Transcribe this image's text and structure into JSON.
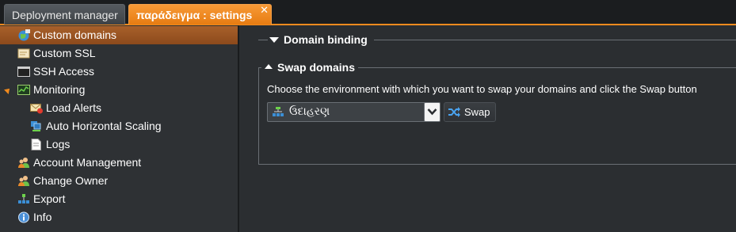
{
  "tabs": [
    {
      "label": "Deployment manager",
      "active": false
    },
    {
      "label": "παράδειγμα : settings",
      "active": true,
      "close_glyph": "✕"
    }
  ],
  "sidebar": {
    "items": [
      {
        "label": "Custom domains",
        "icon": "globe-icon",
        "selected": true
      },
      {
        "label": "Custom SSL",
        "icon": "certificate-icon"
      },
      {
        "label": "SSH Access",
        "icon": "terminal-icon"
      },
      {
        "label": "Monitoring",
        "icon": "monitor-chart-icon",
        "expanded": true
      },
      {
        "label": "Load Alerts",
        "icon": "alert-mail-icon"
      },
      {
        "label": "Auto Horizontal Scaling",
        "icon": "scaling-icon"
      },
      {
        "label": "Logs",
        "icon": "document-icon"
      },
      {
        "label": "Account Management",
        "icon": "users-icon"
      },
      {
        "label": "Change Owner",
        "icon": "change-owner-icon"
      },
      {
        "label": "Export",
        "icon": "export-icon"
      },
      {
        "label": "Info",
        "icon": "info-icon"
      }
    ]
  },
  "main": {
    "domain_binding": {
      "title": "Domain binding",
      "collapsed": true
    },
    "swap_domains": {
      "title": "Swap domains",
      "hint": "Choose the environment with which you want to swap your domains and click the Swap button",
      "environment_value": "ઉદાહરણ",
      "swap_label": "Swap"
    }
  },
  "colors": {
    "accent": "#f08a1e",
    "selected_row": "#9a5423",
    "background": "#2b2e31"
  }
}
